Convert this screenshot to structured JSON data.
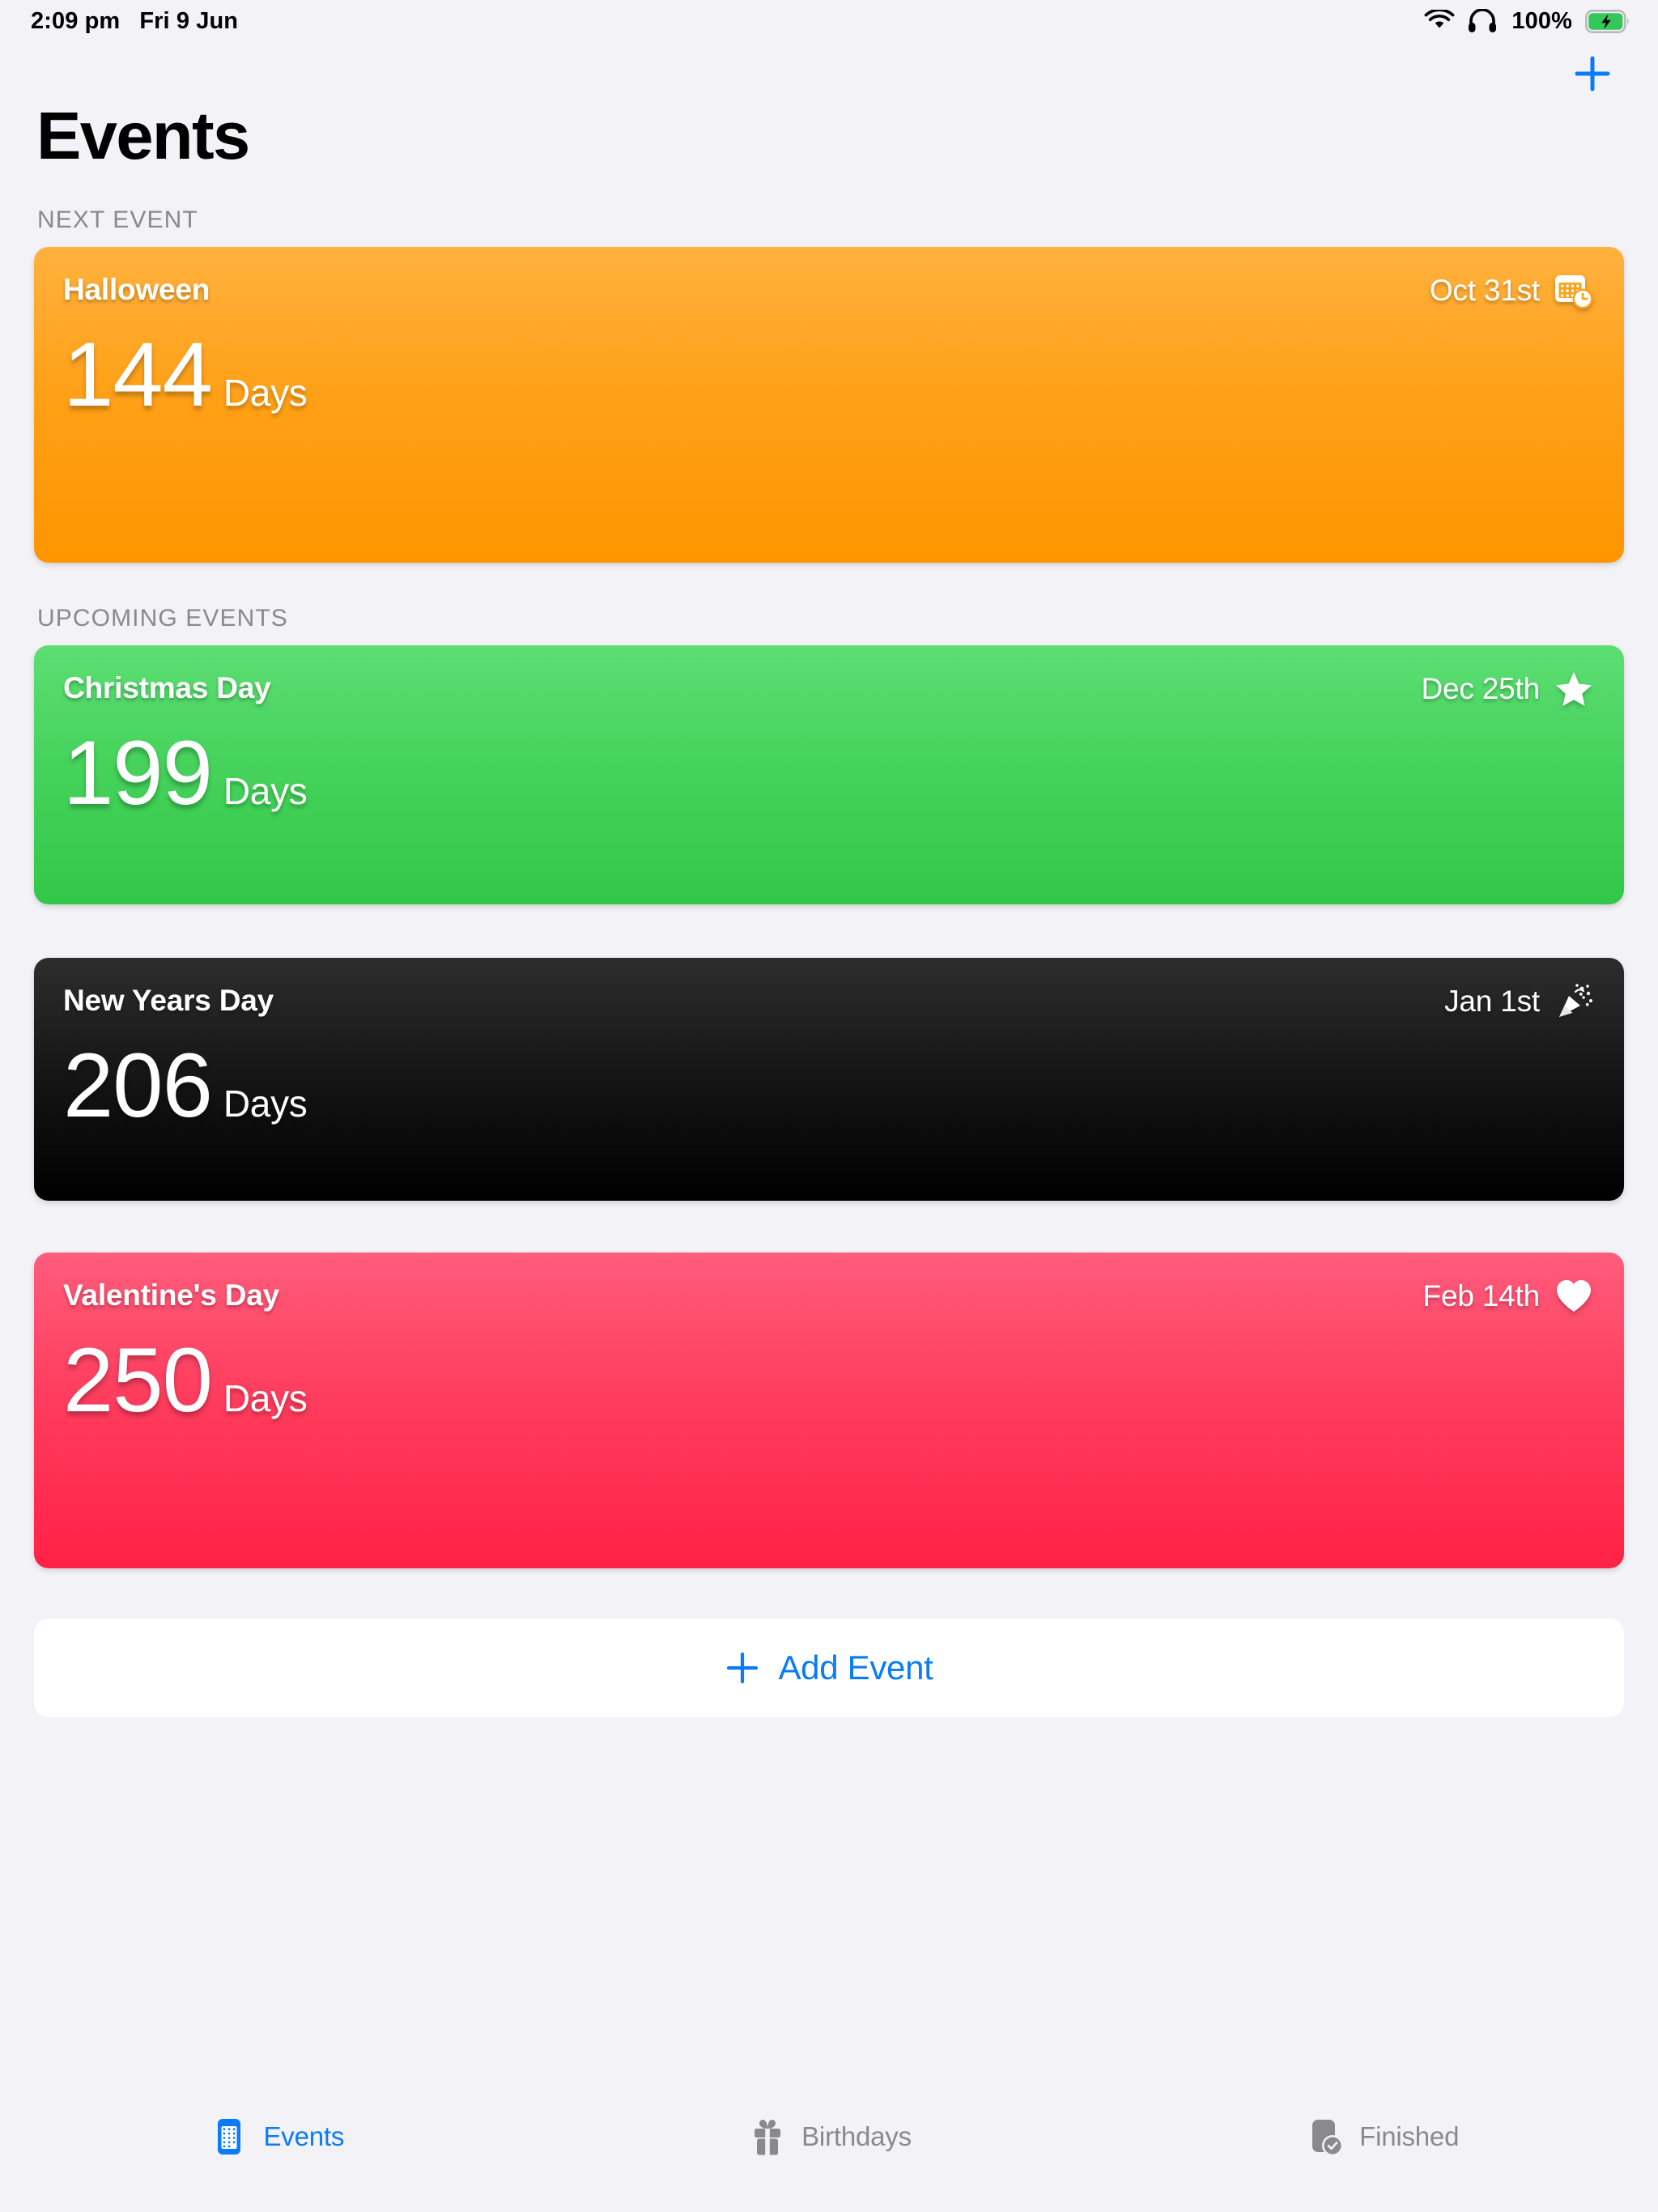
{
  "status_bar": {
    "time": "2:09 pm",
    "date": "Fri 9 Jun",
    "battery_percent": "100%",
    "wifi_icon": "wifi-icon",
    "headphones_icon": "headphones-icon",
    "battery_icon": "battery-charging-icon"
  },
  "nav": {
    "add_icon": "plus-icon"
  },
  "header": {
    "title": "Events"
  },
  "sections": {
    "next_event_label": "NEXT EVENT",
    "upcoming_events_label": "UPCOMING EVENTS"
  },
  "colors": {
    "accent_blue": "#0A7CF5",
    "background": "#F2F2F7",
    "section_text": "#8A8A8E",
    "halloween_top": "#FFB13E",
    "halloween_bottom": "#FF9500",
    "christmas_top": "#5CDE73",
    "christmas_bottom": "#32C748",
    "newyears_top": "#2D2D2D",
    "newyears_bottom": "#000000",
    "valentines_top": "#FF5C7C",
    "valentines_bottom": "#FF2146"
  },
  "next_event": {
    "name": "Halloween",
    "date": "Oct 31st",
    "count": "144",
    "unit": "Days",
    "icon": "calendar-clock-icon"
  },
  "upcoming_events": [
    {
      "name": "Christmas Day",
      "date": "Dec 25th",
      "count": "199",
      "unit": "Days",
      "icon": "star-icon"
    },
    {
      "name": "New Years Day",
      "date": "Jan 1st",
      "count": "206",
      "unit": "Days",
      "icon": "party-popper-icon"
    },
    {
      "name": "Valentine's Day",
      "date": "Feb 14th",
      "count": "250",
      "unit": "Days",
      "icon": "heart-icon"
    }
  ],
  "add_event": {
    "label": "Add Event",
    "icon": "plus-icon"
  },
  "tabs": [
    {
      "label": "Events",
      "icon": "calendar-icon",
      "active": true
    },
    {
      "label": "Birthdays",
      "icon": "gift-icon",
      "active": false
    },
    {
      "label": "Finished",
      "icon": "checked-document-icon",
      "active": false
    }
  ]
}
